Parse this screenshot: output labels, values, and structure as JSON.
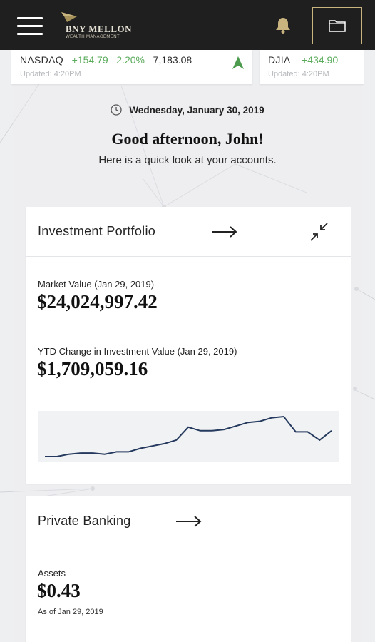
{
  "header": {
    "brand_name": "BNY MELLON",
    "brand_sub": "WEALTH MANAGEMENT",
    "icons": [
      "menu-icon",
      "bell-icon",
      "folder-icon"
    ]
  },
  "tickers": [
    {
      "name": "NASDAQ",
      "change": "+154.79",
      "percent": "2.20%",
      "value": "7,183.08",
      "updated": "Updated: 4:20PM",
      "trend": "up"
    },
    {
      "name": "DJIA",
      "change": "+434.90",
      "updated": "Updated: 4:20PM"
    }
  ],
  "welcome": {
    "date": "Wednesday, January 30, 2019",
    "greeting": "Good afternoon, John!",
    "subtitle": "Here is a quick look at your accounts."
  },
  "investment": {
    "title": "Investment Portfolio",
    "market_label": "Market Value (Jan 29, 2019)",
    "market_value": "$24,024,997.42",
    "ytd_label": "YTD Change in Investment Value (Jan 29, 2019)",
    "ytd_value": "$1,709,059.16",
    "sparkline": [
      8,
      8,
      10,
      11,
      11,
      10,
      12,
      12,
      15,
      17,
      19,
      22,
      33,
      30,
      30,
      31,
      34,
      37,
      38,
      41,
      42,
      29,
      29,
      22,
      30
    ]
  },
  "private_banking": {
    "title": "Private Banking",
    "assets_label": "Assets",
    "assets_value": "$0.43",
    "as_of": "As of Jan 29, 2019"
  },
  "colors": {
    "topbar": "#1f1f1f",
    "gold": "#c9b37e",
    "positive": "#5aab5c",
    "line": "#253a5e"
  }
}
